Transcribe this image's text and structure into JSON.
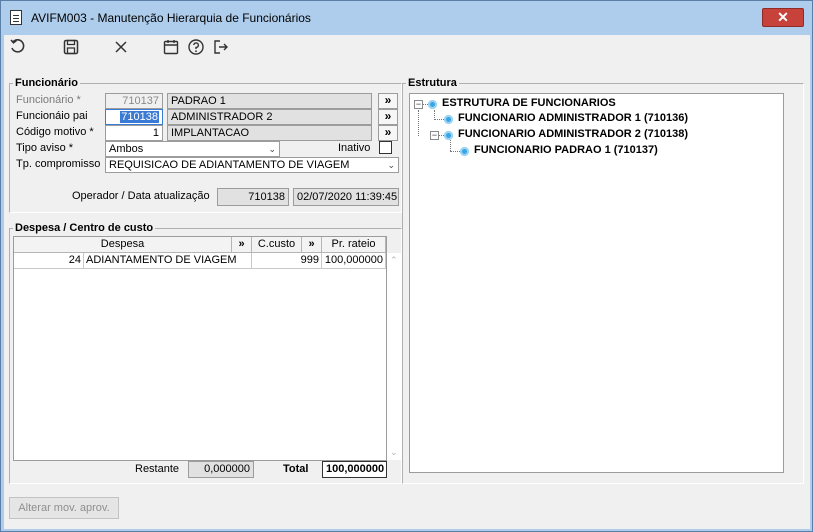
{
  "window": {
    "title": "AVIFM003 - Manutenção Hierarquia de Funcionários",
    "close_label": "✕"
  },
  "toolbar": {
    "refresh_icon": "undo-icon",
    "save_icon": "save-icon",
    "cancel_icon": "close-icon",
    "calendar_icon": "calendar-icon",
    "help_icon": "help-icon",
    "exit_icon": "exit-icon"
  },
  "funcionario": {
    "legend": "Funcionário",
    "funcionario_label": "Funcionário *",
    "funcionario_code": "710137",
    "funcionario_name": "PADRAO 1",
    "pai_label": "Funcionáio pai",
    "pai_code": "710138",
    "pai_name": "ADMINISTRADOR 2",
    "motivo_label": "Código motivo *",
    "motivo_code": "1",
    "motivo_name": "IMPLANTACAO",
    "tipo_aviso_label": "Tipo aviso *",
    "tipo_aviso_value": "Ambos",
    "inativo_label": "Inativo",
    "inativo_checked": false,
    "compromisso_label": "Tp. compromisso",
    "compromisso_value": "REQUISICAO DE ADIANTAMENTO DE VIAGEM",
    "operador_label": "Operador / Data atualização",
    "operador_value": "710138",
    "data_value": "02/07/2020 11:39:45",
    "lookup_label": "»"
  },
  "despesa": {
    "legend": "Despesa / Centro de custo",
    "columns": [
      "Despesa",
      "»",
      "C.custo",
      "»",
      "Pr. rateio"
    ],
    "rows": [
      {
        "code": "24",
        "despesa": "ADIANTAMENTO DE VIAGEM",
        "ccusto": "999",
        "rateio": "100,000000"
      }
    ],
    "restante_label": "Restante",
    "restante_value": "0,000000",
    "total_label": "Total",
    "total_value": "100,000000"
  },
  "estrutura": {
    "legend": "Estrutura",
    "root": "ESTRUTURA DE FUNCIONARIOS",
    "child1": "FUNCIONARIO ADMINISTRADOR 1 (710136)",
    "child2": "FUNCIONARIO ADMINISTRADOR 2 (710138)",
    "grandchild": "FUNCIONARIO PADRAO 1 (710137)"
  },
  "footer": {
    "alterar_label": "Alterar mov. aprov."
  }
}
